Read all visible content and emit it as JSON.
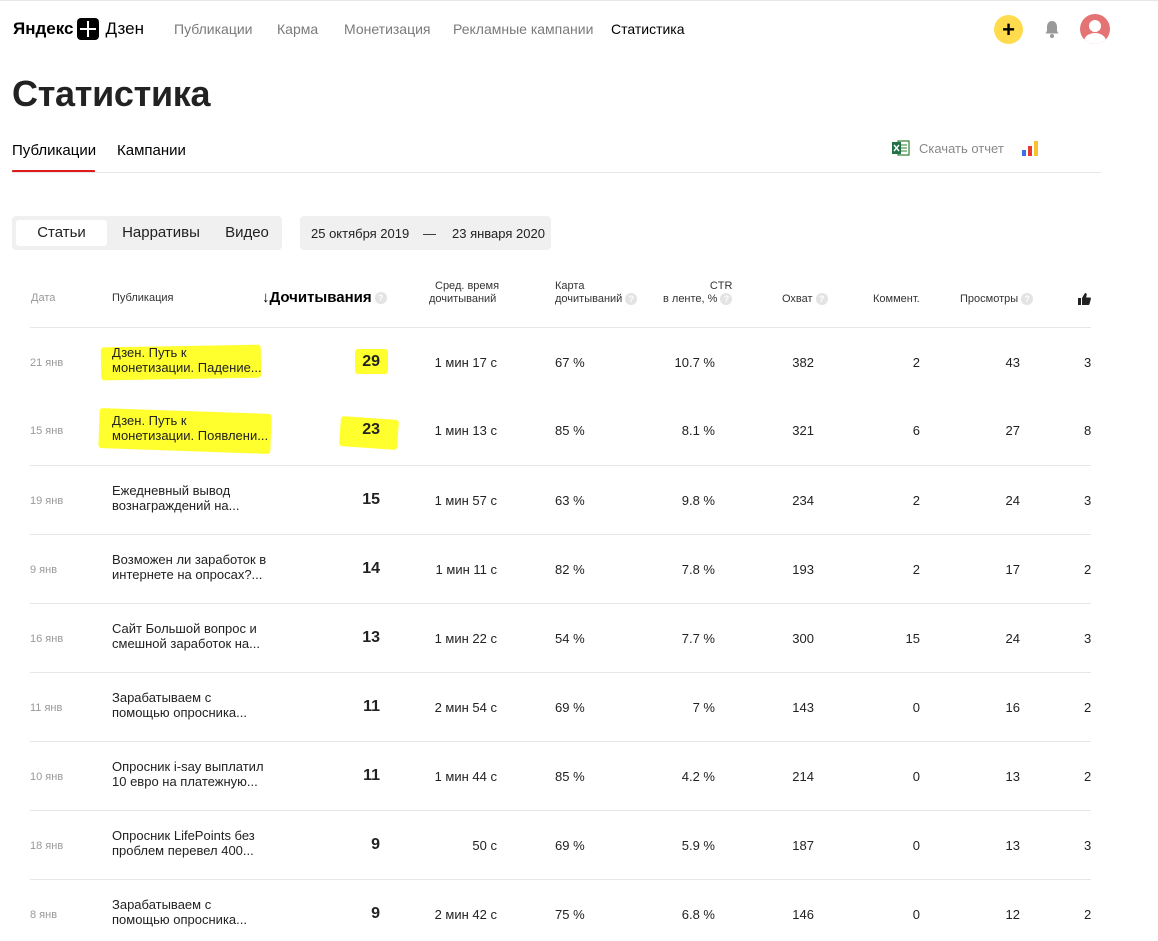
{
  "header": {
    "brand_left": "Яндекс",
    "brand_right": "Дзен",
    "nav": [
      "Публикации",
      "Карма",
      "Монетизация",
      "Рекламные кампании",
      "Статистика"
    ],
    "nav_active": "Статистика",
    "create_label": "+",
    "icons": [
      "plus-icon",
      "bell-icon",
      "avatar"
    ]
  },
  "page": {
    "title": "Статистика",
    "tabs": [
      "Публикации",
      "Кампании"
    ],
    "download_label": "Скачать отчет",
    "segments": [
      "Статьи",
      "Нарративы",
      "Видео"
    ],
    "date_from": "25 октября 2019",
    "date_sep": "—",
    "date_to": "23 января 2020",
    "accent_color": "#e01a1a",
    "highlight_color": "#ffff2e"
  },
  "table": {
    "headers": {
      "date": "Дата",
      "publication": "Публикация",
      "reads": "↓Дочитывания",
      "avg_time_1": "Сред. время",
      "avg_time_2": "дочитываний",
      "map_1": "Карта",
      "map_2": "дочитываний",
      "ctr_1": "CTR",
      "ctr_2": "в ленте, %",
      "reach": "Охват",
      "comments": "Коммент.",
      "views": "Просмотры",
      "help": "?"
    },
    "rows": [
      {
        "date": "21 янв",
        "t1": "Дзен. Путь к",
        "t2": "монетизации. Падение...",
        "reads": "29",
        "time": "1 мин 17 с",
        "map": "67 %",
        "ctr": "10.7 %",
        "reach": "382",
        "comments": "2",
        "views": "43",
        "likes": "3"
      },
      {
        "date": "15 янв",
        "t1": "Дзен. Путь к",
        "t2": "монетизации. Появлени...",
        "reads": "23",
        "time": "1 мин 13 с",
        "map": "85 %",
        "ctr": "8.1 %",
        "reach": "321",
        "comments": "6",
        "views": "27",
        "likes": "8"
      },
      {
        "date": "19 янв",
        "t1": "Ежедневный вывод",
        "t2": "вознаграждений на...",
        "reads": "15",
        "time": "1 мин 57 с",
        "map": "63 %",
        "ctr": "9.8 %",
        "reach": "234",
        "comments": "2",
        "views": "24",
        "likes": "3"
      },
      {
        "date": "9 янв",
        "t1": "Возможен ли заработок в",
        "t2": "интернете на опросах?...",
        "reads": "14",
        "time": "1 мин 11 с",
        "map": "82 %",
        "ctr": "7.8 %",
        "reach": "193",
        "comments": "2",
        "views": "17",
        "likes": "2"
      },
      {
        "date": "16 янв",
        "t1": "Сайт Большой вопрос и",
        "t2": "смешной заработок на...",
        "reads": "13",
        "time": "1 мин 22 с",
        "map": "54 %",
        "ctr": "7.7 %",
        "reach": "300",
        "comments": "15",
        "views": "24",
        "likes": "3"
      },
      {
        "date": "11 янв",
        "t1": "Зарабатываем с",
        "t2": "помощью опросника...",
        "reads": "11",
        "time": "2 мин 54 с",
        "map": "69 %",
        "ctr": "7 %",
        "reach": "143",
        "comments": "0",
        "views": "16",
        "likes": "2"
      },
      {
        "date": "10 янв",
        "t1": "Опросник i-say выплатил",
        "t2": "10 евро на платежную...",
        "reads": "11",
        "time": "1 мин 44 с",
        "map": "85 %",
        "ctr": "4.2 %",
        "reach": "214",
        "comments": "0",
        "views": "13",
        "likes": "2"
      },
      {
        "date": "18 янв",
        "t1": "Опросник LifePoints без",
        "t2": "проблем перевел 400...",
        "reads": "9",
        "time": "50 с",
        "map": "69 %",
        "ctr": "5.9 %",
        "reach": "187",
        "comments": "0",
        "views": "13",
        "likes": "3"
      },
      {
        "date": "8 янв",
        "t1": "Зарабатываем с",
        "t2": "помощью опросника...",
        "reads": "9",
        "time": "2 мин 42 с",
        "map": "75 %",
        "ctr": "6.8 %",
        "reach": "146",
        "comments": "0",
        "views": "12",
        "likes": "2"
      }
    ]
  }
}
